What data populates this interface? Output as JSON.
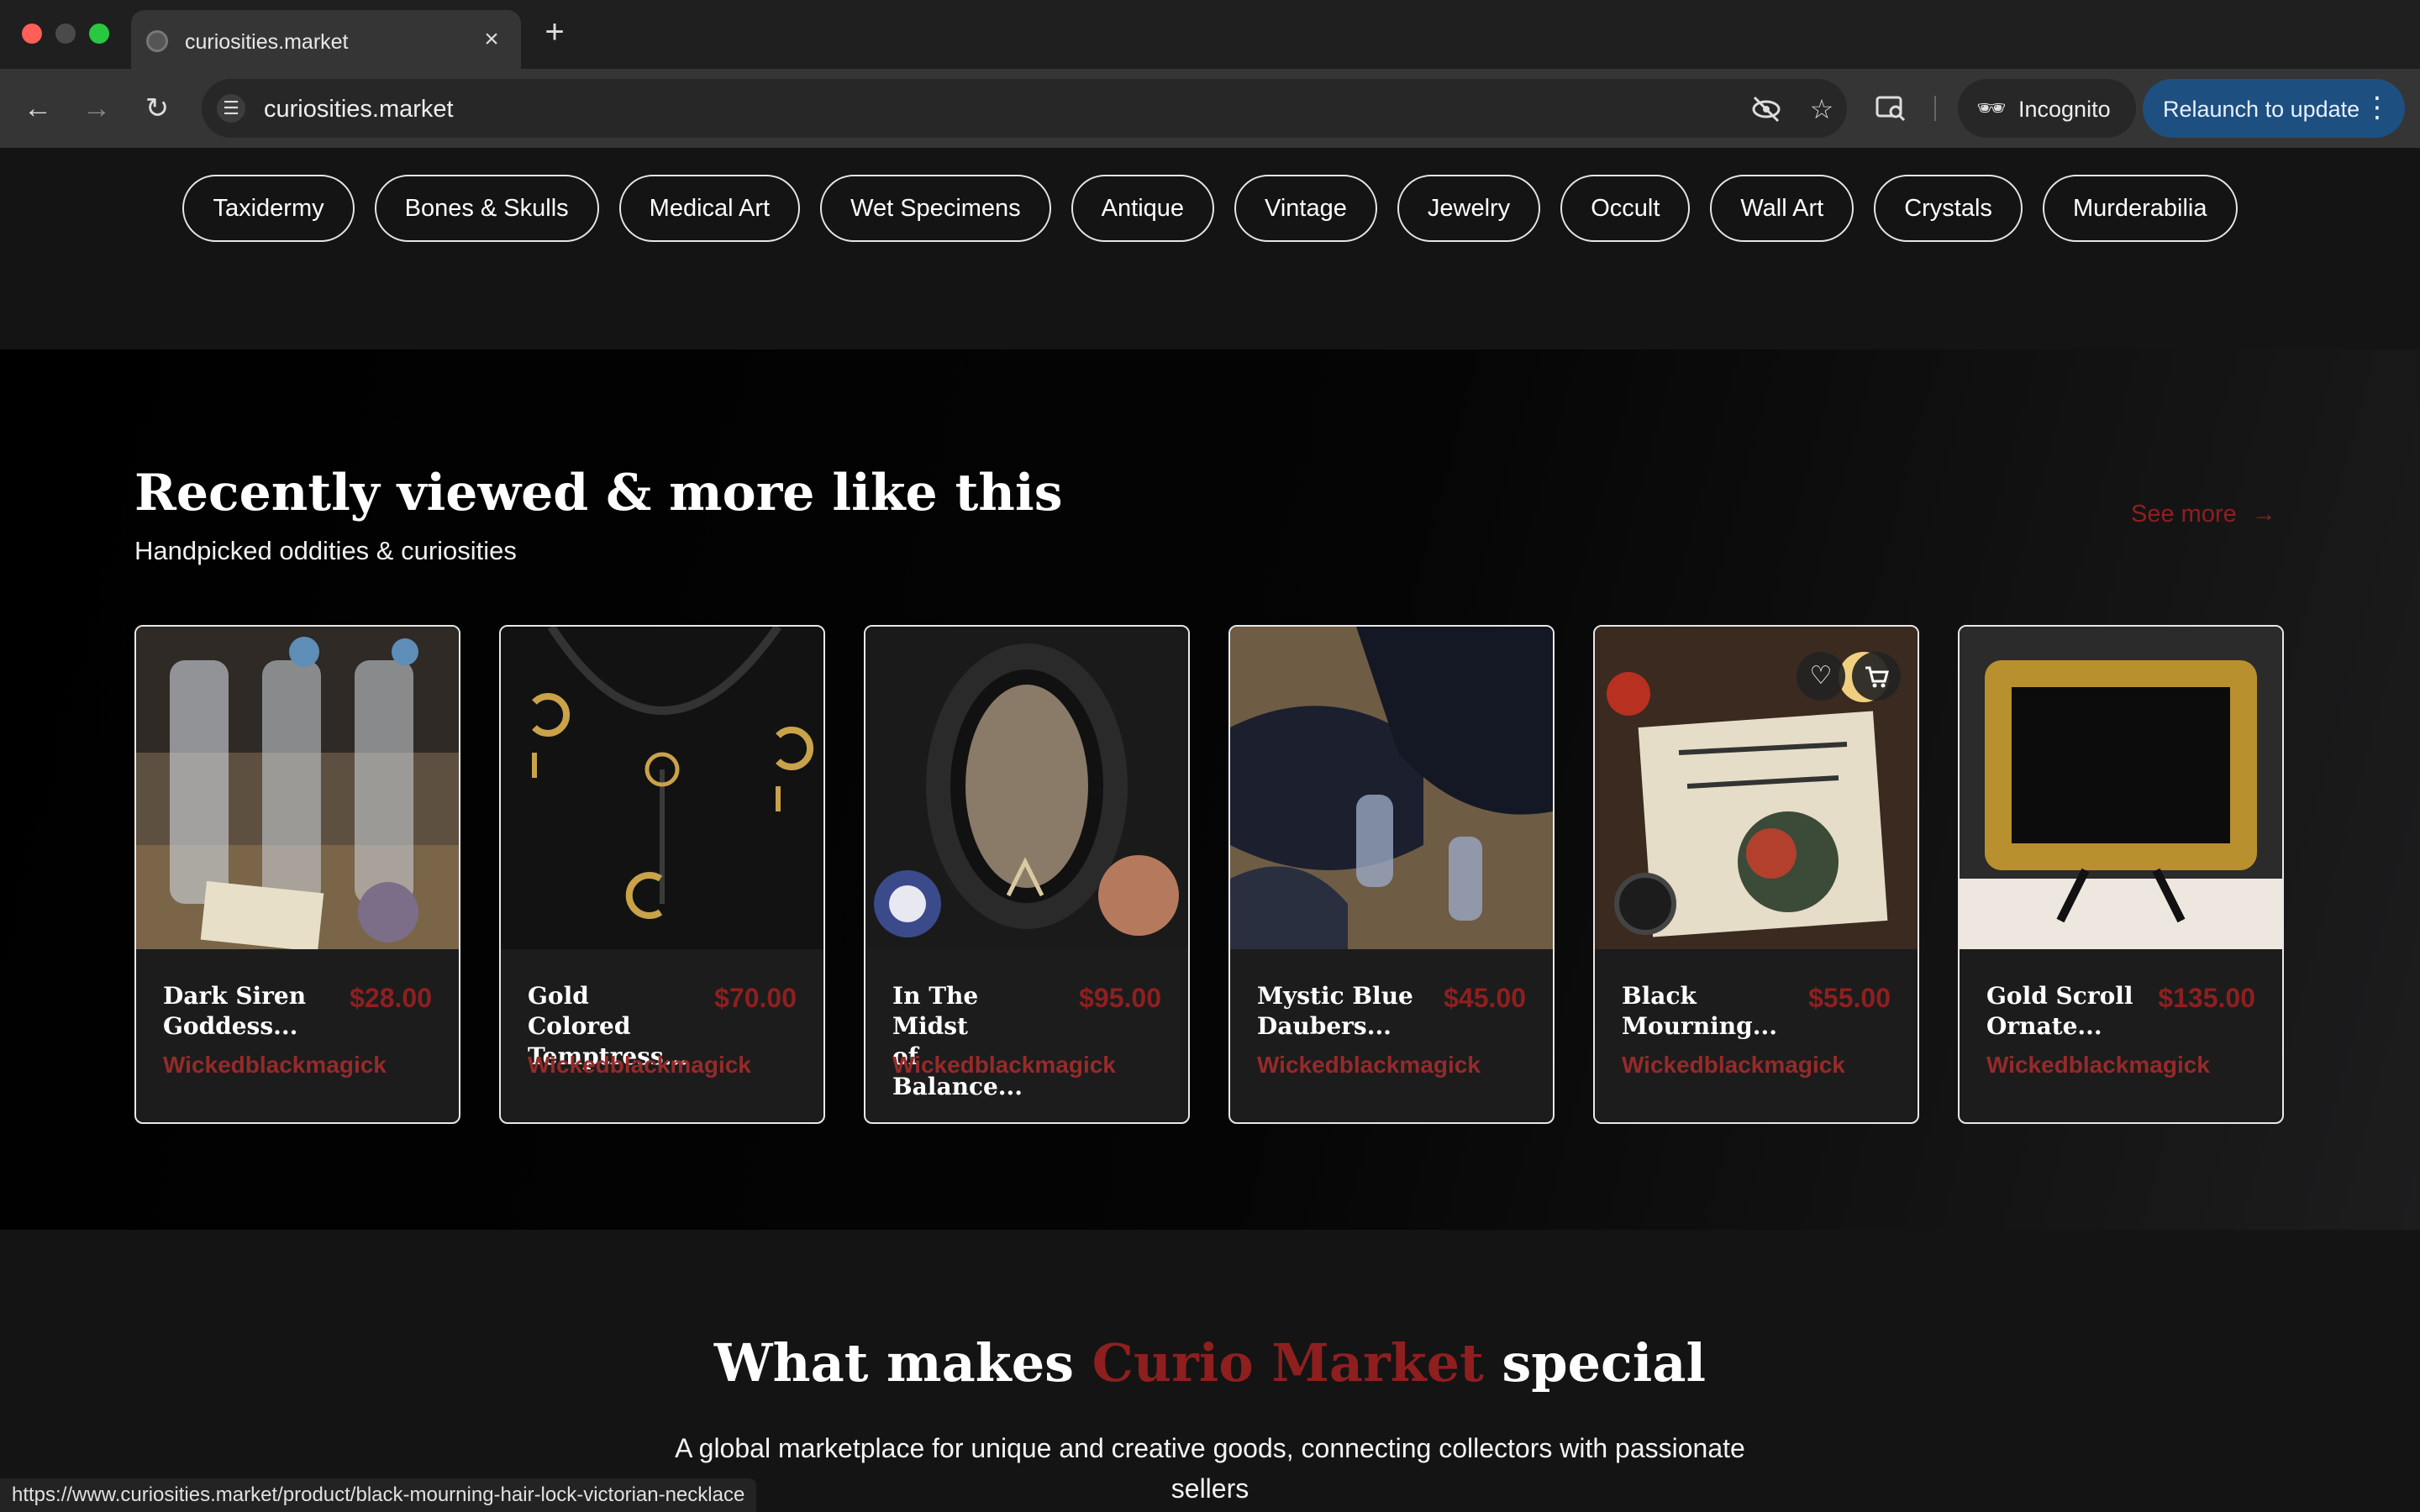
{
  "browser": {
    "tab_title": "curiosities.market",
    "url": "curiosities.market",
    "incognito_label": "Incognito",
    "relaunch_label": "Relaunch to update",
    "status_url": "https://www.curiosities.market/product/black-mourning-hair-lock-victorian-necklace"
  },
  "categories": [
    "Taxidermy",
    "Bones & Skulls",
    "Medical Art",
    "Wet Specimens",
    "Antique",
    "Vintage",
    "Jewelry",
    "Occult",
    "Wall Art",
    "Crystals",
    "Murderabilia"
  ],
  "recent": {
    "title": "Recently viewed & more like this",
    "subtitle": "Handpicked oddities & curiosities",
    "see_more": "See more",
    "products": [
      {
        "name_line1": "Dark Siren",
        "name_line2": "Goddess...",
        "price": "$28.00",
        "seller": "Wickedblackmagick"
      },
      {
        "name_line1": "Gold Colored",
        "name_line2": "Temptress...",
        "price": "$70.00",
        "seller": "Wickedblackmagick"
      },
      {
        "name_line1": "In The Midst",
        "name_line2": "of Balance...",
        "price": "$95.00",
        "seller": "Wickedblackmagick"
      },
      {
        "name_line1": "Mystic Blue",
        "name_line2": "Daubers...",
        "price": "$45.00",
        "seller": "Wickedblackmagick"
      },
      {
        "name_line1": "Black",
        "name_line2": "Mourning...",
        "price": "$55.00",
        "seller": "Wickedblackmagick"
      },
      {
        "name_line1": "Gold Scroll",
        "name_line2": "Ornate...",
        "price": "$135.00",
        "seller": "Wickedblackmagick"
      }
    ]
  },
  "special": {
    "title_before": "What makes ",
    "title_accent": "Curio Market",
    "title_after": " special",
    "subtitle": "A global marketplace for unique and creative goods, connecting collectors with passionate sellers"
  },
  "colors": {
    "accent": "#8f1f1f",
    "relaunch_button": "#1d4f80",
    "background": "#141414"
  },
  "icons": {
    "heart": "heart-icon",
    "cart": "cart-icon",
    "arrow": "arrow-right-icon"
  }
}
